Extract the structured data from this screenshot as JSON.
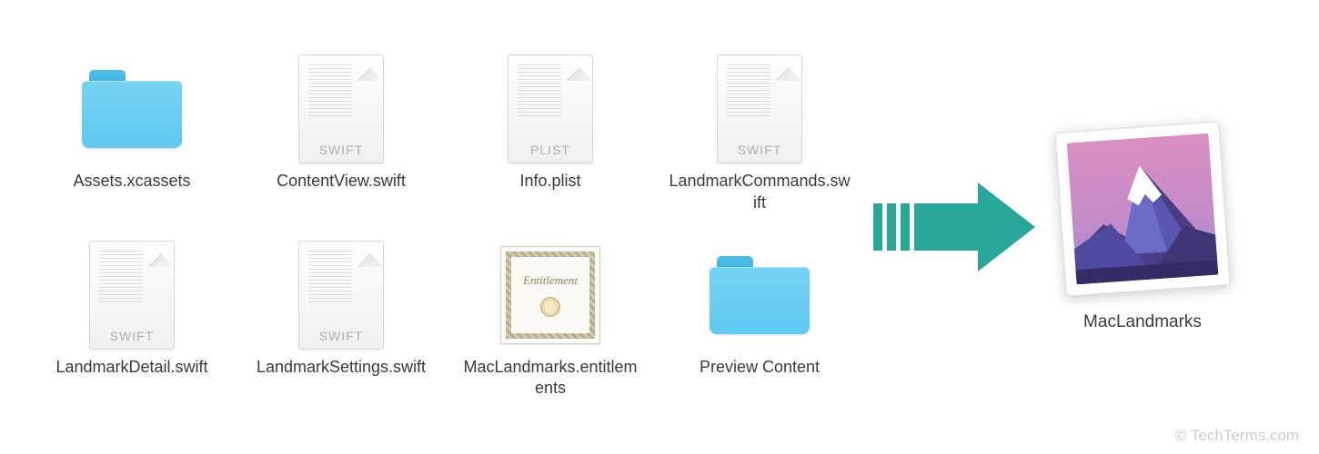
{
  "files": [
    {
      "name": "Assets.xcassets",
      "type": "folder",
      "badge": ""
    },
    {
      "name": "ContentView.swift",
      "type": "doc",
      "badge": "SWIFT"
    },
    {
      "name": "Info.plist",
      "type": "doc",
      "badge": "PLIST"
    },
    {
      "name": "LandmarkCommands.swift",
      "type": "doc",
      "badge": "SWIFT"
    },
    {
      "name": "LandmarkDetail.swift",
      "type": "doc",
      "badge": "SWIFT"
    },
    {
      "name": "LandmarkSettings.swift",
      "type": "doc",
      "badge": "SWIFT"
    },
    {
      "name": "MacLandmarks.entitlements",
      "type": "entitlements",
      "badge": ""
    },
    {
      "name": "Preview Content",
      "type": "folder",
      "badge": ""
    }
  ],
  "entitlements_label": "Entitlement",
  "app": {
    "name": "MacLandmarks"
  },
  "arrow_color": "#27a69a",
  "watermark": "© TechTerms.com"
}
